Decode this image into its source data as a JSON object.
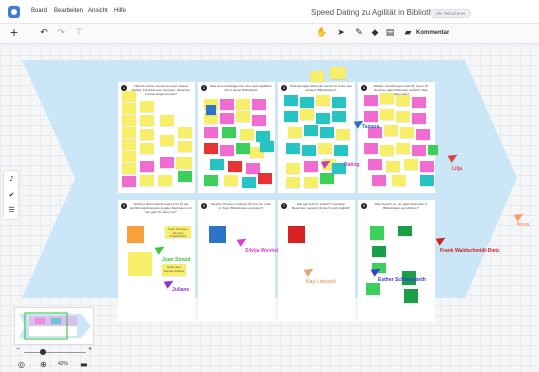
{
  "menubar": {
    "items": [
      "Board",
      "Bearbeiten",
      "Ansicht",
      "Hilfe"
    ],
    "board_title": "Speed Dating zu Agilität in Bibliotheken",
    "participants_badge": "Alle Teilnehmer"
  },
  "toolbar": {
    "left_tools": [
      "add-icon",
      "undo-icon",
      "redo-icon",
      "format-painter-icon"
    ],
    "right_tools": [
      "hand-icon",
      "select-pointer-icon",
      "pen-icon",
      "eraser-icon",
      "sticky-note-icon"
    ],
    "comment_label": "Kommentar"
  },
  "canvas": {
    "background_fish": "#cbe7f7",
    "panels": [
      {
        "number": "1",
        "question": "Habt Ihr schon einmal an einem Speed Dating, Zukunftsreise/ Gruppen- ähnliches Format teilgenommen?"
      },
      {
        "number": "2",
        "question": "Was sind Grundlagen für eine mehr Agilität in Ihrer/ deiner Bibliothek?"
      },
      {
        "number": "3",
        "question": "Welches agile Methoden kennt Ihr schon aus anderen Bibliotheken?"
      },
      {
        "number": "4",
        "question": "Welche Vorstellungen hast Ihr, bevor Ihr Services agile Methoden einführt? Was wären das?"
      },
      {
        "number": "5",
        "question": "Welches Bild entsteht beginnt für Ihr die Einführung/Anwendung agiler Methoden und wie geht Ihr damit um?"
      },
      {
        "number": "6",
        "question": "Welche Themen möchtest Ihr bzw. Ihr noch in Ihrem Bibliotheken erkunden?"
      },
      {
        "number": "7",
        "question": "Wie agil seid Ihr selbst? In welchen Bereichen wünscht Ihr Euch mehr Agilität?"
      },
      {
        "number": "8",
        "question": "Was braucht es, um agile Methoden in Bibliotheken einzuführen?"
      }
    ],
    "panel_labels": {
      "p5_label": "Paris Gruppen stimmen Projekttrains",
      "p5_yellow_label": "Datei über Kunden Aufbau"
    },
    "cursors": [
      {
        "name": "Juan Strazd",
        "color": "#3cc43c"
      },
      {
        "name": "Juliane",
        "color": "#8b36c9"
      },
      {
        "name": "Silvija Wenhel",
        "color": "#d43fd4"
      },
      {
        "name": "Kay Linnasit",
        "color": "#f0a172"
      },
      {
        "name": "Esther Schweigbeth",
        "color": "#3a3ad8"
      },
      {
        "name": "Frank Waldschmidt-Dietz",
        "color": "#cc2222"
      },
      {
        "name": "Lilja",
        "color": "#e04040"
      },
      {
        "name": "Nova",
        "color": "#f2a070"
      },
      {
        "name": "Dating",
        "color": "#c040c0"
      },
      {
        "name": "Tamara",
        "color": "#2e6fcf"
      }
    ]
  },
  "left_tools": [
    "notification-bell-icon",
    "check-circle-icon",
    "list-icon"
  ],
  "bottom_bar": {
    "zoom_minus": "−",
    "zoom_plus": "+",
    "zoom_level": "42%"
  },
  "colors": {
    "yellow": "#f7ee6a",
    "pink": "#f06cd1",
    "cyan": "#27c4c4",
    "green": "#3ccf5a",
    "orange": "#f7a03c",
    "red": "#e43434",
    "blue": "#2b74c9",
    "darkgreen": "#1a9e4a"
  }
}
